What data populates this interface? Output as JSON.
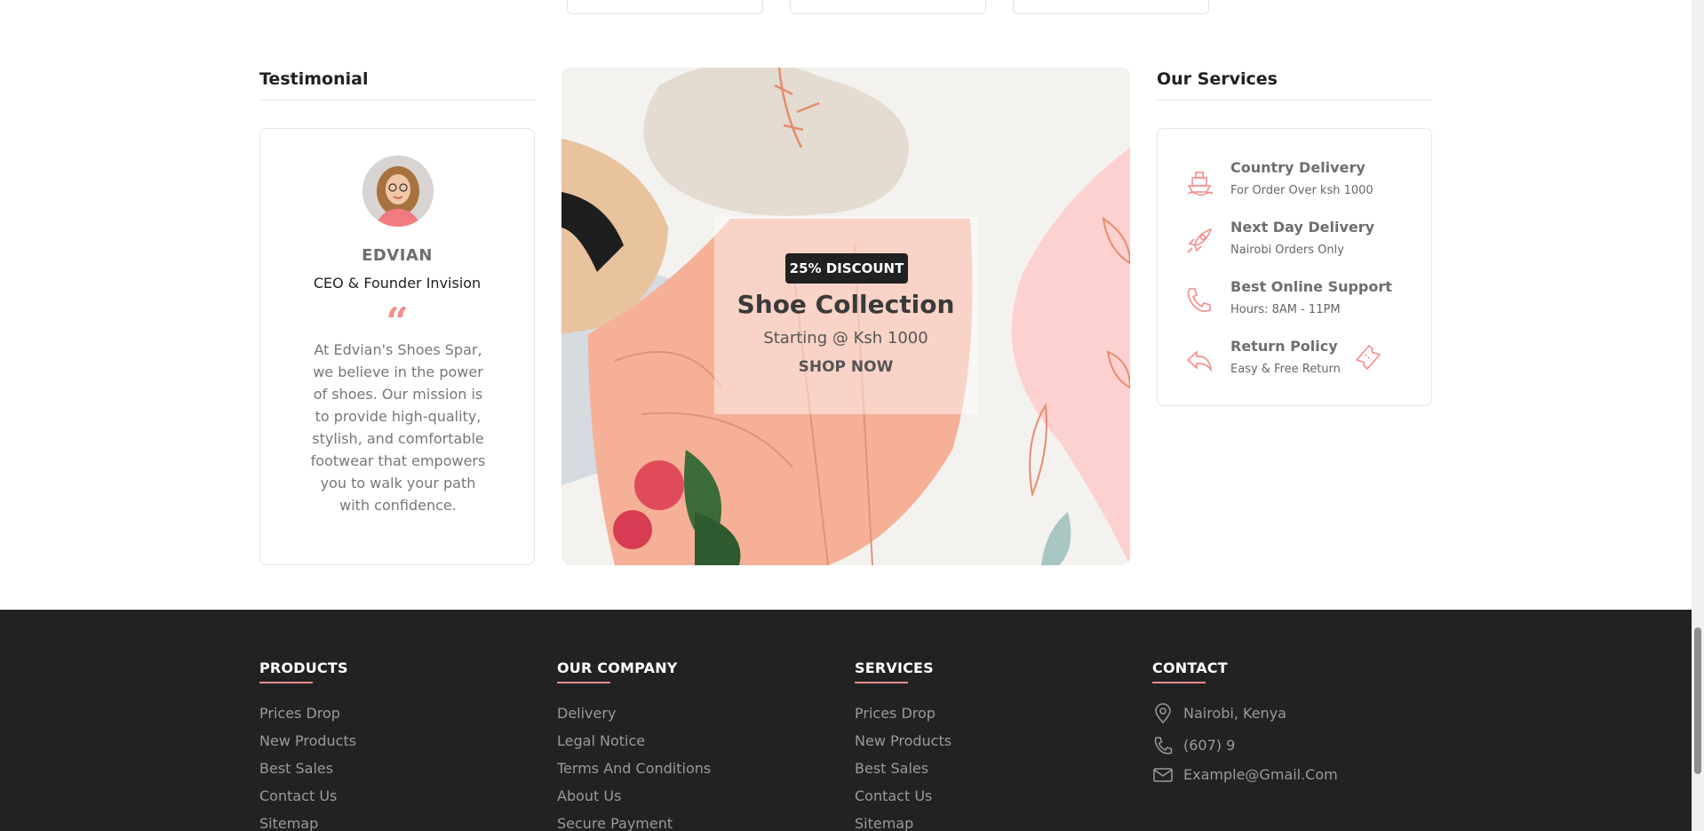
{
  "testimonial": {
    "heading": "Testimonial",
    "name": "EDVIAN",
    "role": "CEO & Founder Invision",
    "quote_mark": "“",
    "text": "At Edvian's Shoes Spar, we believe in the power of shoes. Our mission is to provide high-quality, stylish, and comfortable footwear that empowers you to walk your path with confidence."
  },
  "banner": {
    "badge": "25% DISCOUNT",
    "title": "Shoe Collection",
    "subtitle": "Starting @ Ksh 1000",
    "cta": "SHOP NOW"
  },
  "services": {
    "heading": "Our Services",
    "items": [
      {
        "title": "Country Delivery",
        "subtitle": "For Order Over ksh 1000",
        "icon": "ship-icon"
      },
      {
        "title": "Next Day Delivery",
        "subtitle": "Nairobi Orders Only",
        "icon": "rocket-icon"
      },
      {
        "title": "Best Online Support",
        "subtitle": "Hours: 8AM - 11PM",
        "icon": "phone-icon"
      },
      {
        "title": "Return Policy",
        "subtitle": "Easy & Free Return",
        "icon": "return-arrow-icon"
      }
    ]
  },
  "footer": {
    "products": {
      "heading": "PRODUCTS",
      "links": [
        "Prices Drop",
        "New Products",
        "Best Sales",
        "Contact Us",
        "Sitemap"
      ]
    },
    "company": {
      "heading": "OUR COMPANY",
      "links": [
        "Delivery",
        "Legal Notice",
        "Terms And Conditions",
        "About Us",
        "Secure Payment"
      ]
    },
    "services": {
      "heading": "SERVICES",
      "links": [
        "Prices Drop",
        "New Products",
        "Best Sales",
        "Contact Us",
        "Sitemap"
      ]
    },
    "contact": {
      "heading": "CONTACT",
      "address": "Nairobi, Kenya",
      "phone": "(607) 9",
      "email": "Example@Gmail.Com"
    }
  },
  "colors": {
    "accent": "#f68b8b",
    "footer_bg": "#222222",
    "badge_bg": "#212121"
  }
}
